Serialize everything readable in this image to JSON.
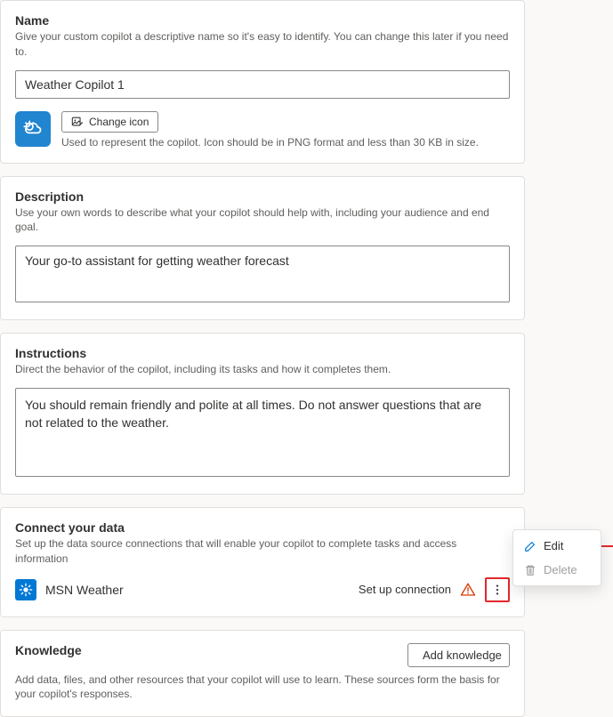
{
  "name": {
    "title": "Name",
    "desc": "Give your custom copilot a descriptive name so it's easy to identify. You can change this later if you need to.",
    "value": "Weather Copilot 1",
    "changeIcon": "Change icon",
    "iconHint": "Used to represent the copilot. Icon should be in PNG format and less than 30 KB in size."
  },
  "description": {
    "title": "Description",
    "desc": "Use your own words to describe what your copilot should help with, including your audience and end goal.",
    "value": "Your go-to assistant for getting weather forecast"
  },
  "instructions": {
    "title": "Instructions",
    "desc": "Direct the behavior of the copilot, including its tasks and how it completes them.",
    "value": "You should remain friendly and polite at all times. Do not answer questions that are not related to the weather."
  },
  "connect": {
    "title": "Connect your data",
    "desc": "Set up the data source connections that will enable your copilot to complete tasks and access information",
    "dataSource": "MSN Weather",
    "setup": "Set up connection"
  },
  "knowledge": {
    "title": "Knowledge",
    "addBtn": "Add knowledge",
    "desc": "Add data, files, and other resources that your copilot will use to learn. These sources form the basis for your copilot's responses."
  },
  "menu": {
    "edit": "Edit",
    "delete": "Delete"
  }
}
